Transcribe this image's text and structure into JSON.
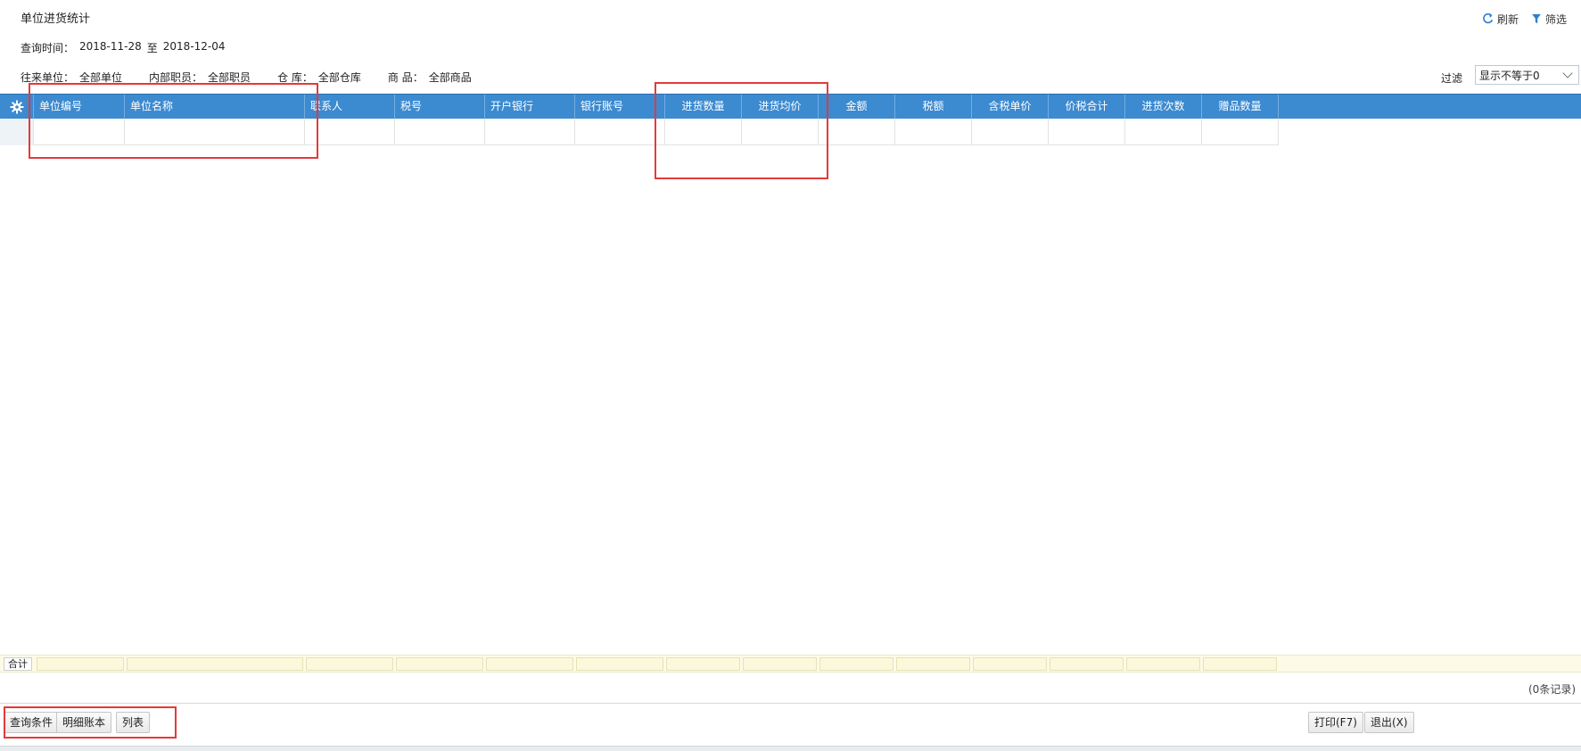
{
  "page": {
    "title": "单位进货统计"
  },
  "header_actions": {
    "refresh": "刷新",
    "filter": "筛选"
  },
  "query": {
    "label": "查询时间：",
    "start": "2018-11-28",
    "to": "至",
    "end": "2018-12-04"
  },
  "conditions": [
    {
      "label": "往来单位：",
      "value": "全部单位"
    },
    {
      "label": "内部职员：",
      "value": "全部职员"
    },
    {
      "label": "仓  库：",
      "value": "全部仓库"
    },
    {
      "label": "商  品：",
      "value": "全部商品"
    }
  ],
  "filter": {
    "label": "过滤",
    "selected": "显示不等于0"
  },
  "grid": {
    "columns": [
      "单位编号",
      "单位名称",
      "联系人",
      "税号",
      "开户银行",
      "银行账号",
      "进货数量",
      "进货均价",
      "金额",
      "税额",
      "含税单价",
      "价税合计",
      "进货次数",
      "赠品数量"
    ]
  },
  "totals": {
    "label": "合计"
  },
  "footer": {
    "record_count": "(0条记录)",
    "buttons_left": [
      "查询条件",
      "明细账本",
      "列表"
    ],
    "buttons_right": [
      "打印(F7)",
      "退出(X)"
    ]
  },
  "colors": {
    "header_bg": "#3c8ad0",
    "annotation_red": "#e33a3a"
  }
}
